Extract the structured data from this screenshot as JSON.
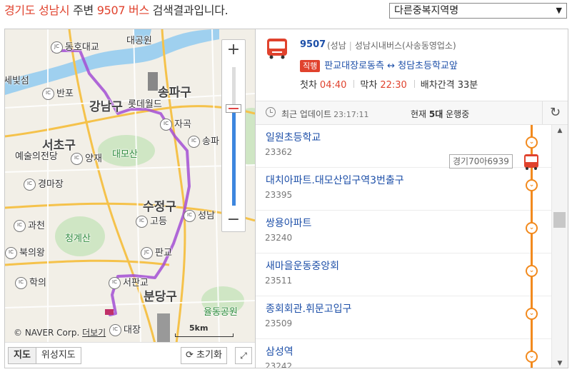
{
  "header": {
    "region": "경기도 성남시",
    "mid": " 주변 ",
    "route": "9507 버스",
    "tail": " 검색결과입니다."
  },
  "region_select": {
    "value": "다른중복지역명"
  },
  "map": {
    "labels": {
      "donghodaegyo": "동호대교",
      "daegongwon": "대공원",
      "sebitseom": "세빛섬",
      "banpo": "반포",
      "gangnamgu": "강남구",
      "lotteworld": "롯데월드",
      "songpagu": "송파구",
      "jagok": "자곡",
      "songpa": "송파",
      "seochogu": "서초구",
      "yesul": "예술의전당",
      "yangjae": "양재",
      "daemosan": "대모산",
      "gyeongmajang": "경마장",
      "sujeonggu": "수정구",
      "godeung": "고등",
      "seongnam": "성남",
      "gwacheon": "과천",
      "cheonggyesan": "청계산",
      "bukuiwang": "북의왕",
      "pangyo": "판교",
      "seopangyo": "서판교",
      "hakui": "학의",
      "bundanggu": "분당구",
      "yuldong": "율동공원",
      "daejang": "대장"
    },
    "zoom_in": "+",
    "zoom_out": "−",
    "zoom_level": 0.3,
    "credit": "© NAVER Corp.",
    "more": "더보기",
    "scale": "5km",
    "map_type": [
      "지도",
      "위성지도"
    ],
    "reset": "초기화",
    "expand_icon": "expand-icon"
  },
  "route": {
    "number": "9507",
    "region": "(성남",
    "company": "성남시내버스(사송동영업소)",
    "badge": "직행",
    "path": "판교대장로동측 ↔ 청담초등학교앞",
    "first_label": "첫차",
    "first_time": "04:40",
    "last_label": "막차",
    "last_time": "22:30",
    "interval_label": "배차간격",
    "interval": "33분",
    "accent": "#e0422d",
    "line_color": "#f28a1e"
  },
  "status": {
    "update_label": "최근 업데이트",
    "update_time": "23:17:11",
    "op_prefix": "현재",
    "op_count": "5대",
    "op_suffix": "운행중"
  },
  "stops": [
    {
      "name": "일원초등학교",
      "id": "23362"
    },
    {
      "name": "대치아파트.대모산입구역3번출구",
      "id": "23395"
    },
    {
      "name": "쌍용아파트",
      "id": "23240"
    },
    {
      "name": "새마을운동중앙회",
      "id": "23511"
    },
    {
      "name": "종회회관.휘문고입구",
      "id": "23509"
    },
    {
      "name": "삼성역",
      "id": "23242"
    }
  ],
  "bus_plate": "경기70아6939"
}
